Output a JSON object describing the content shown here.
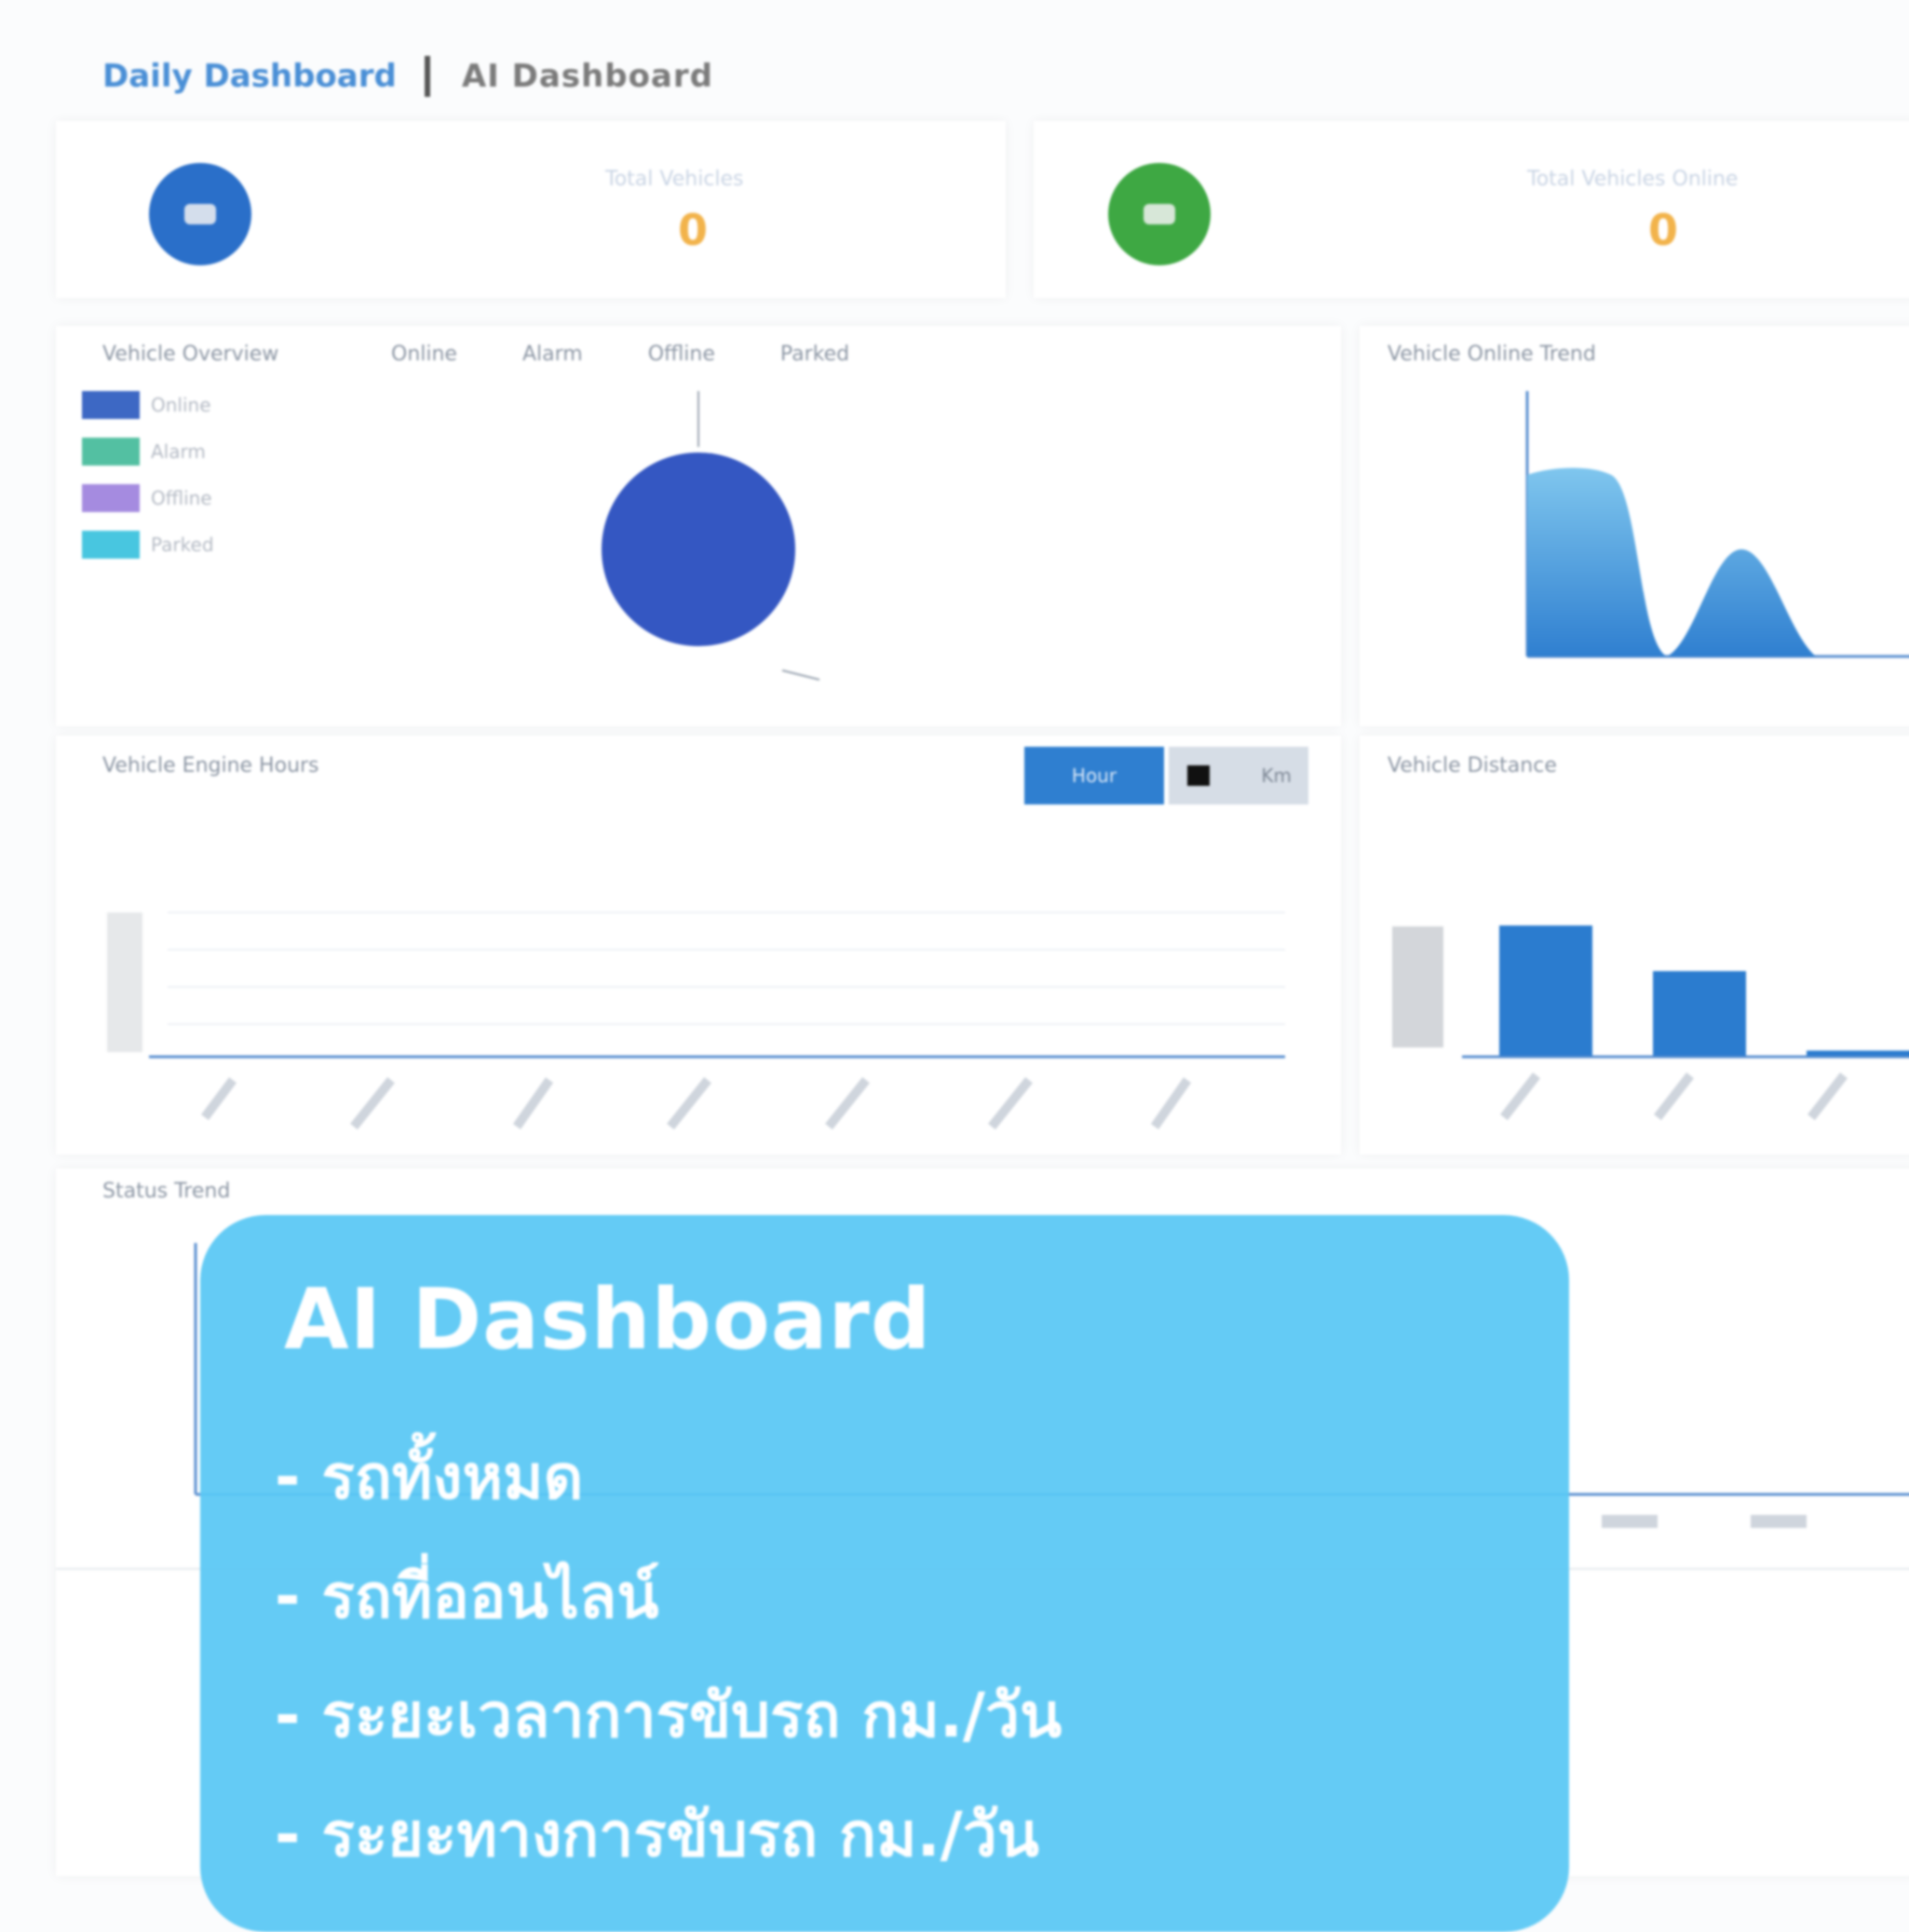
{
  "tabs": [
    {
      "label": "Daily Dashboard"
    },
    {
      "label": "AI Dashboard"
    }
  ],
  "stats": [
    {
      "icon": "car-icon",
      "color": "#2a6fc9",
      "label": "Total Vehicles",
      "value": "0"
    },
    {
      "icon": "online-icon",
      "color": "#3ea843",
      "label": "Total Vehicles Online",
      "value": "0"
    }
  ],
  "vehicle_panel": {
    "title": "Vehicle Overview",
    "filters": [
      "Online",
      "Alarm",
      "Offline",
      "Parked"
    ],
    "legend": [
      {
        "label": "Online",
        "color": "#3d68c4"
      },
      {
        "label": "Alarm",
        "color": "#53c0a2"
      },
      {
        "label": "Offline",
        "color": "#a58be0"
      },
      {
        "label": "Parked",
        "color": "#48c6e0"
      }
    ]
  },
  "speed_panel": {
    "title": "Vehicle Online Trend"
  },
  "engine_panel": {
    "title": "Vehicle Engine Hours",
    "toggle": [
      "Hour",
      "Km"
    ]
  },
  "distance_panel": {
    "title": "Vehicle Distance"
  },
  "lower_panel": {
    "title": "Status Trend"
  },
  "chart_data": [
    {
      "type": "pie",
      "labels": [
        "Online"
      ],
      "values": [
        100
      ],
      "colors": [
        "#3457c2"
      ],
      "title": "",
      "legend": [
        "Online",
        "Alarm",
        "Offline",
        "Parked"
      ]
    },
    {
      "type": "area",
      "x": [
        1,
        2,
        3,
        4,
        5,
        6
      ],
      "values": [
        0,
        3.8,
        0,
        2.0,
        0,
        0
      ],
      "title": "",
      "ylim": [
        0,
        5
      ]
    },
    {
      "type": "bar",
      "categories": [
        "",
        "",
        "",
        "",
        "",
        "",
        ""
      ],
      "values": [
        0,
        0,
        0,
        0,
        0,
        0,
        0
      ],
      "title": ""
    },
    {
      "type": "bar",
      "categories": [
        "",
        "",
        ""
      ],
      "values": [
        100,
        65,
        4
      ],
      "title": ""
    }
  ],
  "overlay": {
    "title": "AI Dashboard",
    "items": [
      "- รถทั้งหมด",
      "- รถที่ออนไลน์",
      "- ระยะเวลาการขับรถ กม./วัน",
      "- ระยะทางการขับรถ กม./วัน"
    ]
  }
}
